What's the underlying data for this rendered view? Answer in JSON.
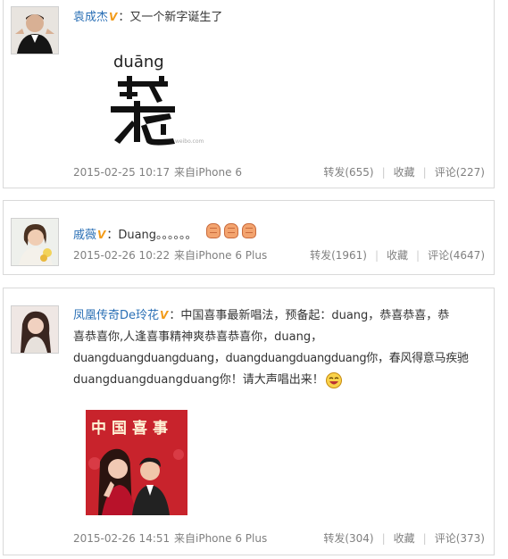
{
  "posts": [
    {
      "user": "袁成杰",
      "text": "又一个新字诞生了",
      "image": {
        "pinyin": "duāng",
        "character": "⿺",
        "watermark": "weibo.com"
      },
      "time": "2015-02-25 10:17",
      "source": "来自iPhone 6",
      "actions": {
        "repost": "转发(655)",
        "fav": "收藏",
        "comment": "评论(227)"
      }
    },
    {
      "user": "戚薇",
      "text": "Duang。。。。。。",
      "time": "2015-02-26 10:22",
      "source": "来自iPhone 6 Plus",
      "actions": {
        "repost": "转发(1961)",
        "fav": "收藏",
        "comment": "评论(4647)"
      }
    },
    {
      "user": "凤凰传奇De玲花",
      "text_lines": [
        "中国喜事最新唱法，预备起：duang，恭喜恭喜，恭",
        "喜恭喜你,人逢喜事精神爽恭喜恭喜你，duang，",
        "duangduangduangduang，duangduangduangduang你，春风得意马疾驰",
        "duangduangduangduang你！请大声唱出来！"
      ],
      "image": {
        "title": "中国喜事"
      },
      "time": "2015-02-26 14:51",
      "source": "来自iPhone 6 Plus",
      "actions": {
        "repost": "转发(304)",
        "fav": "收藏",
        "comment": "评论(373)"
      }
    }
  ],
  "colors": {
    "link": "#2a6fb5",
    "meta": "#808080",
    "badge": "#f29b19"
  }
}
